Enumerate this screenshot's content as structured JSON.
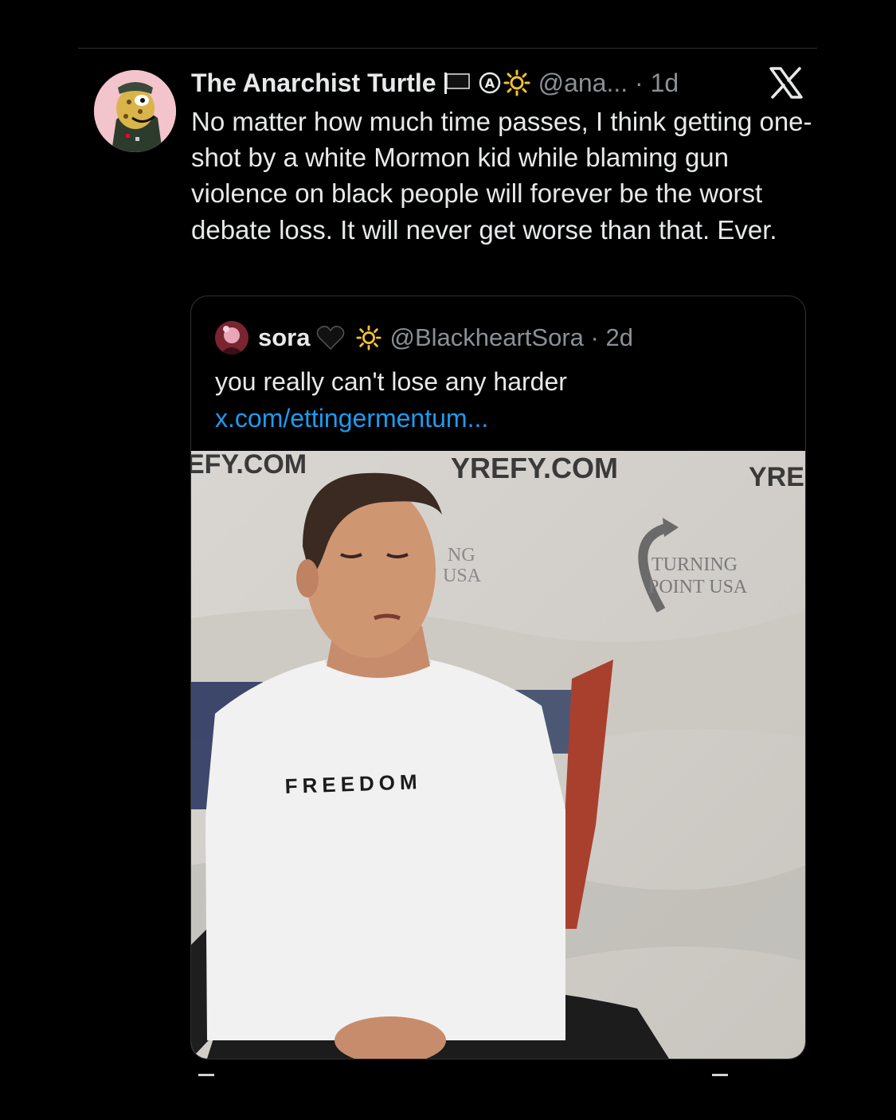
{
  "tweet": {
    "display_name": "The Anarchist Turtle",
    "handle_and_time": "@ana... · 1d",
    "text": "No matter how much time passes, I think getting one-shot by a white Mormon kid while blaming gun violence on black people will forever be the worst debate loss. It will never get worse than that. Ever.",
    "badges": [
      "black-flag-icon",
      "anarchy-icon",
      "sun-icon"
    ]
  },
  "platform_logo": "x-logo-icon",
  "quote": {
    "display_name": "sora",
    "handle_and_time": "@BlackheartSora · 2d",
    "text": "you really can't lose any harder ",
    "link_text": "x.com/ettingermentum...",
    "badges": [
      "black-heart-icon",
      "sun-icon"
    ],
    "media": {
      "banner_texts": [
        "EFY.COM",
        "YREFY.COM",
        "YRE"
      ],
      "logo_text_1": "TURNING",
      "logo_text_2": "POINT USA",
      "partial_logo_text_1": "NG",
      "partial_logo_text_2": "USA",
      "shirt_text": "FREEDOM"
    }
  },
  "colors": {
    "background": "#000000",
    "text": "#e7e9ea",
    "muted": "#8b9096",
    "link": "#1d9bf0",
    "border": "#2f3336"
  }
}
